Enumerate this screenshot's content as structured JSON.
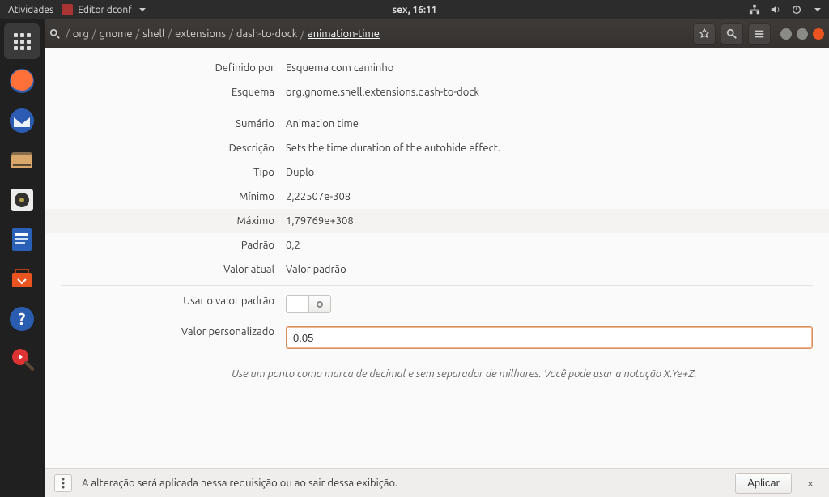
{
  "panel": {
    "activities": "Atividades",
    "app_name": "Editor dconf",
    "clock": "sex, 16:11"
  },
  "breadcrumb": {
    "segments": [
      "org",
      "gnome",
      "shell",
      "extensions",
      "dash-to-dock",
      "animation-time"
    ]
  },
  "fields": {
    "defined_by_label": "Definido por",
    "defined_by_value": "Esquema com caminho",
    "schema_label": "Esquema",
    "schema_value": "org.gnome.shell.extensions.dash-to-dock",
    "summary_label": "Sumário",
    "summary_value": "Animation time",
    "description_label": "Descrição",
    "description_value": "Sets the time duration of the autohide effect.",
    "type_label": "Tipo",
    "type_value": "Duplo",
    "minimum_label": "Mínimo",
    "minimum_value": "2,22507e-308",
    "maximum_label": "Máximo",
    "maximum_value": "1,79769e+308",
    "default_label": "Padrão",
    "default_value": "0,2",
    "current_label": "Valor atual",
    "current_value": "Valor padrão",
    "use_default_label": "Usar o valor padrão",
    "custom_value_label": "Valor personalizado",
    "custom_value": "0.05",
    "hint": "Use um ponto como marca de decimal e sem separador de milhares. Você pode usar a notação X.Ye+Z."
  },
  "infobar": {
    "message": "A alteração será aplicada nessa requisição ou ao sair dessa exibição.",
    "apply": "Aplicar",
    "dismiss": "×"
  }
}
